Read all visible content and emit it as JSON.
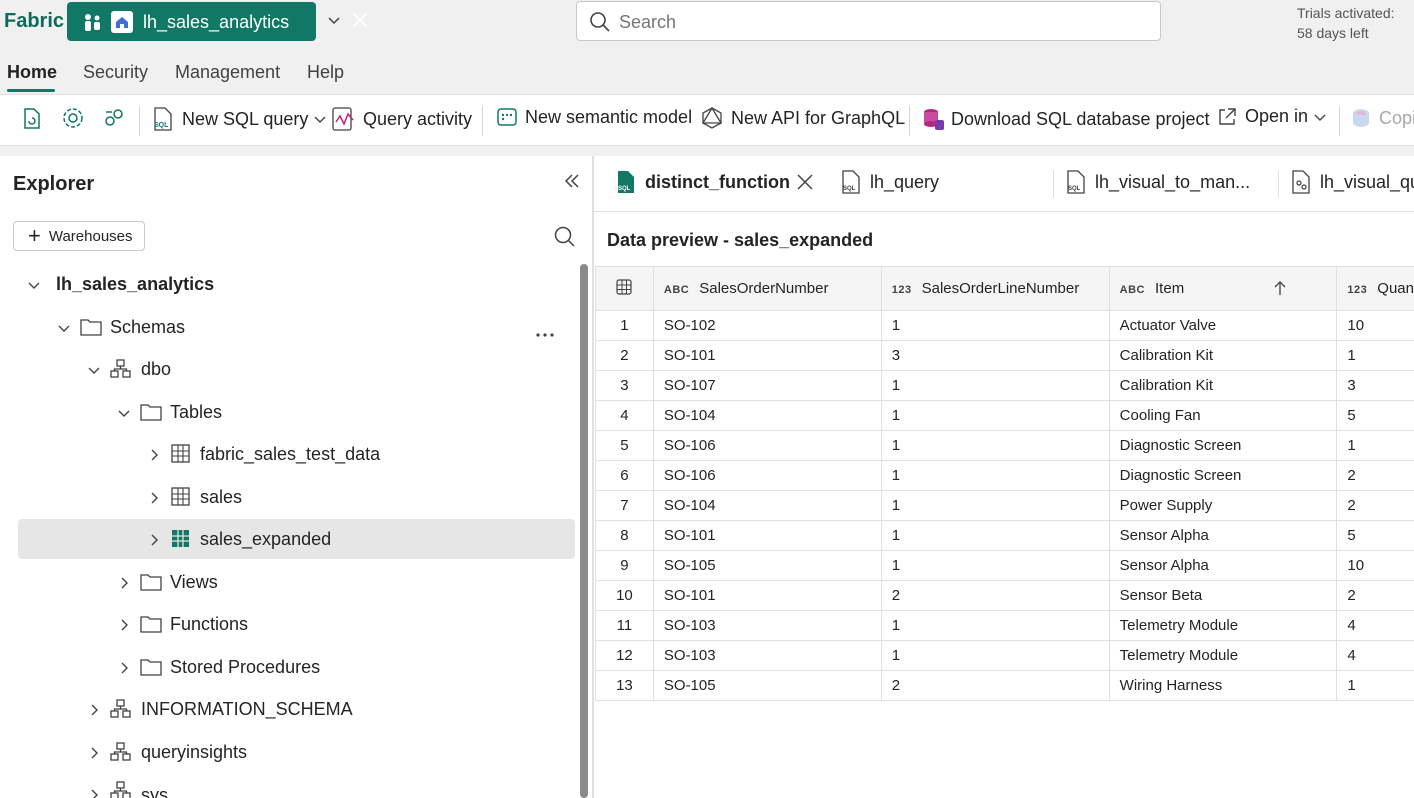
{
  "app": {
    "brand": "Fabric",
    "workspace": "lh_sales_analytics",
    "search_placeholder": "Search",
    "trial_line1": "Trials activated:",
    "trial_line2": "58 days left"
  },
  "menu": {
    "home": "Home",
    "security": "Security",
    "management": "Management",
    "help": "Help"
  },
  "ribbon": {
    "new_sql_query": "New SQL query",
    "query_activity": "Query activity",
    "new_semantic_model": "New semantic model",
    "new_api_graphql": "New API for GraphQL",
    "download_project": "Download SQL database project",
    "open_in": "Open in",
    "copilot": "Copi"
  },
  "explorer": {
    "title": "Explorer",
    "warehouses_button": "Warehouses",
    "tree": {
      "root": "lh_sales_analytics",
      "schemas": "Schemas",
      "dbo": "dbo",
      "tables": "Tables",
      "table1": "fabric_sales_test_data",
      "table2": "sales",
      "table3": "sales_expanded",
      "views": "Views",
      "functions": "Functions",
      "stored_procedures": "Stored Procedures",
      "information_schema": "INFORMATION_SCHEMA",
      "queryinsights": "queryinsights",
      "sys": "sys"
    }
  },
  "tabs": {
    "tab1": "distinct_function",
    "tab2": "lh_query",
    "tab3": "lh_visual_to_man...",
    "tab4": "lh_visual_que"
  },
  "preview": {
    "title": "Data preview - sales_expanded",
    "type_abc": "ABC",
    "type_123": "123",
    "columns": {
      "col1": "SalesOrderNumber",
      "col2": "SalesOrderLineNumber",
      "col3": "Item",
      "col4": "Quan"
    },
    "rows": [
      {
        "n": "1",
        "order": "SO-102",
        "line": "1",
        "item": "Actuator Valve",
        "qty": "10"
      },
      {
        "n": "2",
        "order": "SO-101",
        "line": "3",
        "item": "Calibration Kit",
        "qty": "1"
      },
      {
        "n": "3",
        "order": "SO-107",
        "line": "1",
        "item": "Calibration Kit",
        "qty": "3"
      },
      {
        "n": "4",
        "order": "SO-104",
        "line": "1",
        "item": "Cooling Fan",
        "qty": "5"
      },
      {
        "n": "5",
        "order": "SO-106",
        "line": "1",
        "item": "Diagnostic Screen",
        "qty": "1"
      },
      {
        "n": "6",
        "order": "SO-106",
        "line": "1",
        "item": "Diagnostic Screen",
        "qty": "2"
      },
      {
        "n": "7",
        "order": "SO-104",
        "line": "1",
        "item": "Power Supply",
        "qty": "2"
      },
      {
        "n": "8",
        "order": "SO-101",
        "line": "1",
        "item": "Sensor Alpha",
        "qty": "5"
      },
      {
        "n": "9",
        "order": "SO-105",
        "line": "1",
        "item": "Sensor Alpha",
        "qty": "10"
      },
      {
        "n": "10",
        "order": "SO-101",
        "line": "2",
        "item": "Sensor Beta",
        "qty": "2"
      },
      {
        "n": "11",
        "order": "SO-103",
        "line": "1",
        "item": "Telemetry Module",
        "qty": "4"
      },
      {
        "n": "12",
        "order": "SO-103",
        "line": "1",
        "item": "Telemetry Module",
        "qty": "4"
      },
      {
        "n": "13",
        "order": "SO-105",
        "line": "2",
        "item": "Wiring Harness",
        "qty": "1"
      }
    ]
  },
  "colors": {
    "accent": "#117865",
    "brand_text": "#0e6b5c"
  }
}
